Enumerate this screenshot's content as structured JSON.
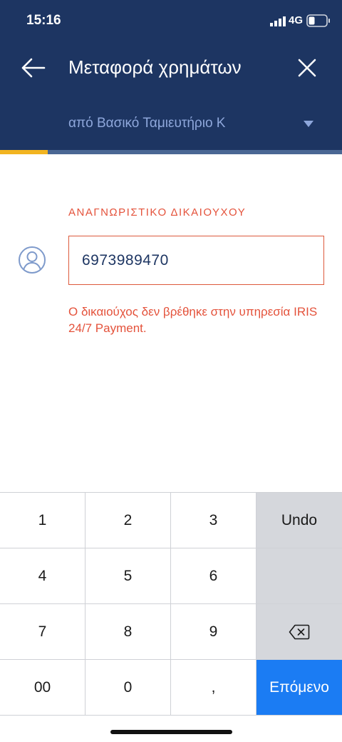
{
  "status_bar": {
    "time": "15:16",
    "network": "4G",
    "signal_icon": "signal-bars-icon",
    "battery_icon": "battery-icon"
  },
  "header": {
    "title": "Μεταφορά χρημάτων",
    "back_icon": "arrow-left-icon",
    "close_icon": "close-icon",
    "account": "από Βασικό Ταμιευτήριο Κ",
    "account_icon": "chevron-down-icon",
    "progress_fraction": 0.14,
    "colors": {
      "background": "#1d3562",
      "accent": "#f2b420"
    }
  },
  "form": {
    "label": "ΑΝΑΓΝΩΡΙΣΤΙΚΟ ΔΙΚΑΙΟΥΧΟΥ",
    "value": "6973989470",
    "error": "Ο δικαιούχος δεν βρέθηκε στην υπηρεσία IRIS 24/7 Payment.",
    "avatar_icon": "user-circle-icon",
    "error_color": "#e4523b"
  },
  "keyboard": {
    "keys": [
      "1",
      "2",
      "3",
      "Undo",
      "4",
      "5",
      "6",
      "",
      "7",
      "8",
      "9",
      "",
      "00",
      "0",
      ",",
      "Επόμενο"
    ],
    "backspace_icon": "backspace-icon",
    "next_color": "#1b7cf3"
  }
}
